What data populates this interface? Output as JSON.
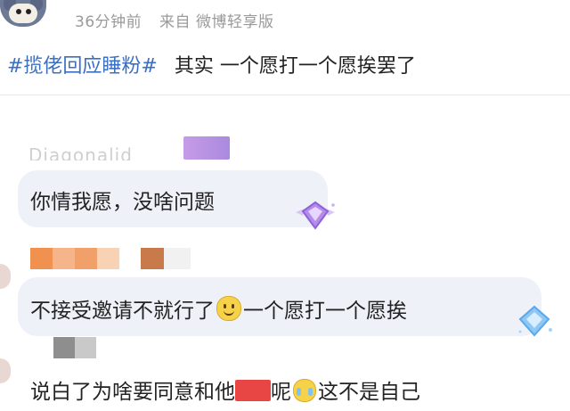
{
  "post": {
    "time": "36分钟前",
    "source": "来自 微博轻享版",
    "hashtag": "#揽佬回应睡粉#",
    "text": "其实 一个愿打一个愿挨罢了"
  },
  "comments": [
    {
      "text": "你情我愿，没啥问题"
    },
    {
      "text_before": "不接受邀请不就行了",
      "text_after": "一个愿打一个愿挨"
    },
    {
      "text_before": "说白了为啥要同意和他",
      "text_mid": "呢",
      "text_after": "这不是自己"
    }
  ],
  "colors": {
    "hashtag": "#3b6fc2",
    "bubble": "#eef1f8",
    "redaction": "#e84545",
    "mosaic1": [
      "#f0914f",
      "#f5b489",
      "#f1a06a",
      "#f8d2b5"
    ],
    "mosaic2": [
      "#8e8e8e",
      "#c9c9c9"
    ]
  }
}
